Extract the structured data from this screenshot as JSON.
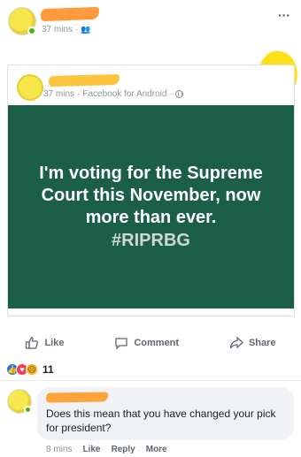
{
  "post": {
    "time": "37 mins",
    "privacy_icon": "friends-icon"
  },
  "shared": {
    "time": "37 mins",
    "separator": "·",
    "source": "Facebook for Android",
    "privacy_icon": "globe-icon",
    "banner_text": "I'm voting for the Supreme Court this November, now more than ever.",
    "banner_hashtag": "#RIPRBG",
    "banner_color": "#1b5f49"
  },
  "actions": {
    "like": "Like",
    "comment": "Comment",
    "share": "Share"
  },
  "reactions": {
    "types": [
      "like",
      "love",
      "sad"
    ],
    "count": "11"
  },
  "comment": {
    "text": "Does this mean that you have changed your pick for president?",
    "time": "8 mins",
    "like": "Like",
    "reply": "Reply",
    "more": "More"
  }
}
